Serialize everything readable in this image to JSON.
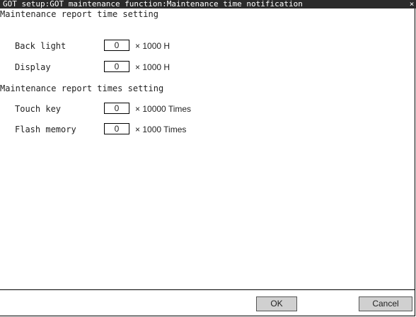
{
  "window": {
    "title": " GOT setup:GOT maintenance function:Maintenance time notification",
    "close_glyph": "×"
  },
  "time_setting": {
    "heading": "Maintenance report time setting",
    "rows": [
      {
        "label": "Back light",
        "value": "0",
        "unit": "× 1000 H"
      },
      {
        "label": "Display",
        "value": "0",
        "unit": "× 1000 H"
      }
    ]
  },
  "times_setting": {
    "heading": "Maintenance report times setting",
    "rows": [
      {
        "label": "Touch key",
        "value": "0",
        "unit": "× 10000 Times"
      },
      {
        "label": "Flash memory",
        "value": "0",
        "unit": "× 1000 Times"
      }
    ]
  },
  "footer": {
    "ok_label": "OK",
    "cancel_label": "Cancel"
  }
}
